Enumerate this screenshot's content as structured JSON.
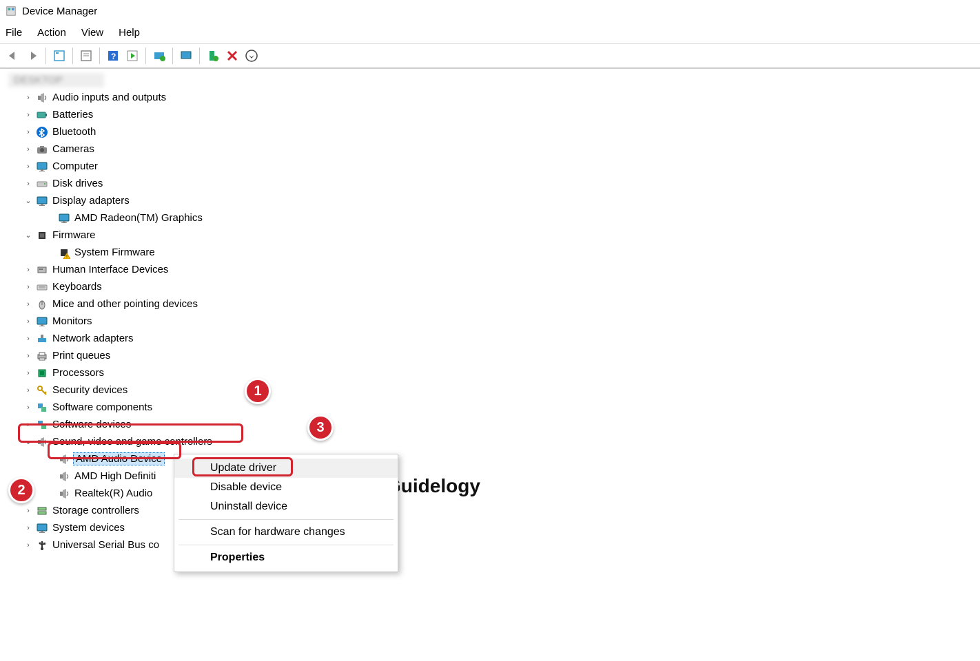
{
  "window": {
    "title": "Device Manager"
  },
  "menubar": {
    "file": "File",
    "action": "Action",
    "view": "View",
    "help": "Help"
  },
  "root": {
    "name": "DESKTOP"
  },
  "categories": [
    {
      "id": "audio-io",
      "label": "Audio inputs and outputs",
      "expanded": false,
      "icon": "speaker"
    },
    {
      "id": "batteries",
      "label": "Batteries",
      "expanded": false,
      "icon": "battery"
    },
    {
      "id": "bluetooth",
      "label": "Bluetooth",
      "expanded": false,
      "icon": "bluetooth"
    },
    {
      "id": "cameras",
      "label": "Cameras",
      "expanded": false,
      "icon": "camera"
    },
    {
      "id": "computer",
      "label": "Computer",
      "expanded": false,
      "icon": "monitor"
    },
    {
      "id": "diskdrives",
      "label": "Disk drives",
      "expanded": false,
      "icon": "disk"
    },
    {
      "id": "display",
      "label": "Display adapters",
      "expanded": true,
      "icon": "monitor",
      "children": [
        {
          "id": "amd-radeon",
          "label": "AMD Radeon(TM) Graphics",
          "icon": "monitor"
        }
      ]
    },
    {
      "id": "firmware",
      "label": "Firmware",
      "expanded": true,
      "icon": "chip",
      "children": [
        {
          "id": "sysfw",
          "label": "System Firmware",
          "icon": "chip-warn"
        }
      ]
    },
    {
      "id": "hid",
      "label": "Human Interface Devices",
      "expanded": false,
      "icon": "hid"
    },
    {
      "id": "keyboards",
      "label": "Keyboards",
      "expanded": false,
      "icon": "keyboard"
    },
    {
      "id": "mice",
      "label": "Mice and other pointing devices",
      "expanded": false,
      "icon": "mouse"
    },
    {
      "id": "monitors",
      "label": "Monitors",
      "expanded": false,
      "icon": "monitor"
    },
    {
      "id": "network",
      "label": "Network adapters",
      "expanded": false,
      "icon": "network"
    },
    {
      "id": "printq",
      "label": "Print queues",
      "expanded": false,
      "icon": "printer"
    },
    {
      "id": "processors",
      "label": "Processors",
      "expanded": false,
      "icon": "cpu"
    },
    {
      "id": "security",
      "label": "Security devices",
      "expanded": false,
      "icon": "key"
    },
    {
      "id": "swcomp",
      "label": "Software components",
      "expanded": false,
      "icon": "component"
    },
    {
      "id": "swdev",
      "label": "Software devices",
      "expanded": false,
      "icon": "component"
    },
    {
      "id": "sound",
      "label": "Sound, video and game controllers",
      "expanded": true,
      "icon": "speaker",
      "children": [
        {
          "id": "amd-audio",
          "label": "AMD Audio Device",
          "icon": "speaker",
          "selected": true
        },
        {
          "id": "amd-hd",
          "label": "AMD High Definiti",
          "icon": "speaker"
        },
        {
          "id": "realtek",
          "label": "Realtek(R) Audio",
          "icon": "speaker"
        }
      ]
    },
    {
      "id": "storage",
      "label": "Storage controllers",
      "expanded": false,
      "icon": "storage"
    },
    {
      "id": "sysdev",
      "label": "System devices",
      "expanded": false,
      "icon": "monitor"
    },
    {
      "id": "usb",
      "label": "Universal Serial Bus co",
      "expanded": false,
      "icon": "usb"
    }
  ],
  "context_menu": {
    "items": [
      {
        "id": "update",
        "label": "Update driver",
        "hover": true
      },
      {
        "id": "disable",
        "label": "Disable device"
      },
      {
        "id": "uninstall",
        "label": "Uninstall device"
      },
      {
        "sep": true
      },
      {
        "id": "scan",
        "label": "Scan for hardware changes"
      },
      {
        "sep": true
      },
      {
        "id": "props",
        "label": "Properties",
        "bold": true
      }
    ]
  },
  "annotations": {
    "one": "1",
    "two": "2",
    "three": "3"
  },
  "watermark": {
    "text": "Guidelogy"
  }
}
